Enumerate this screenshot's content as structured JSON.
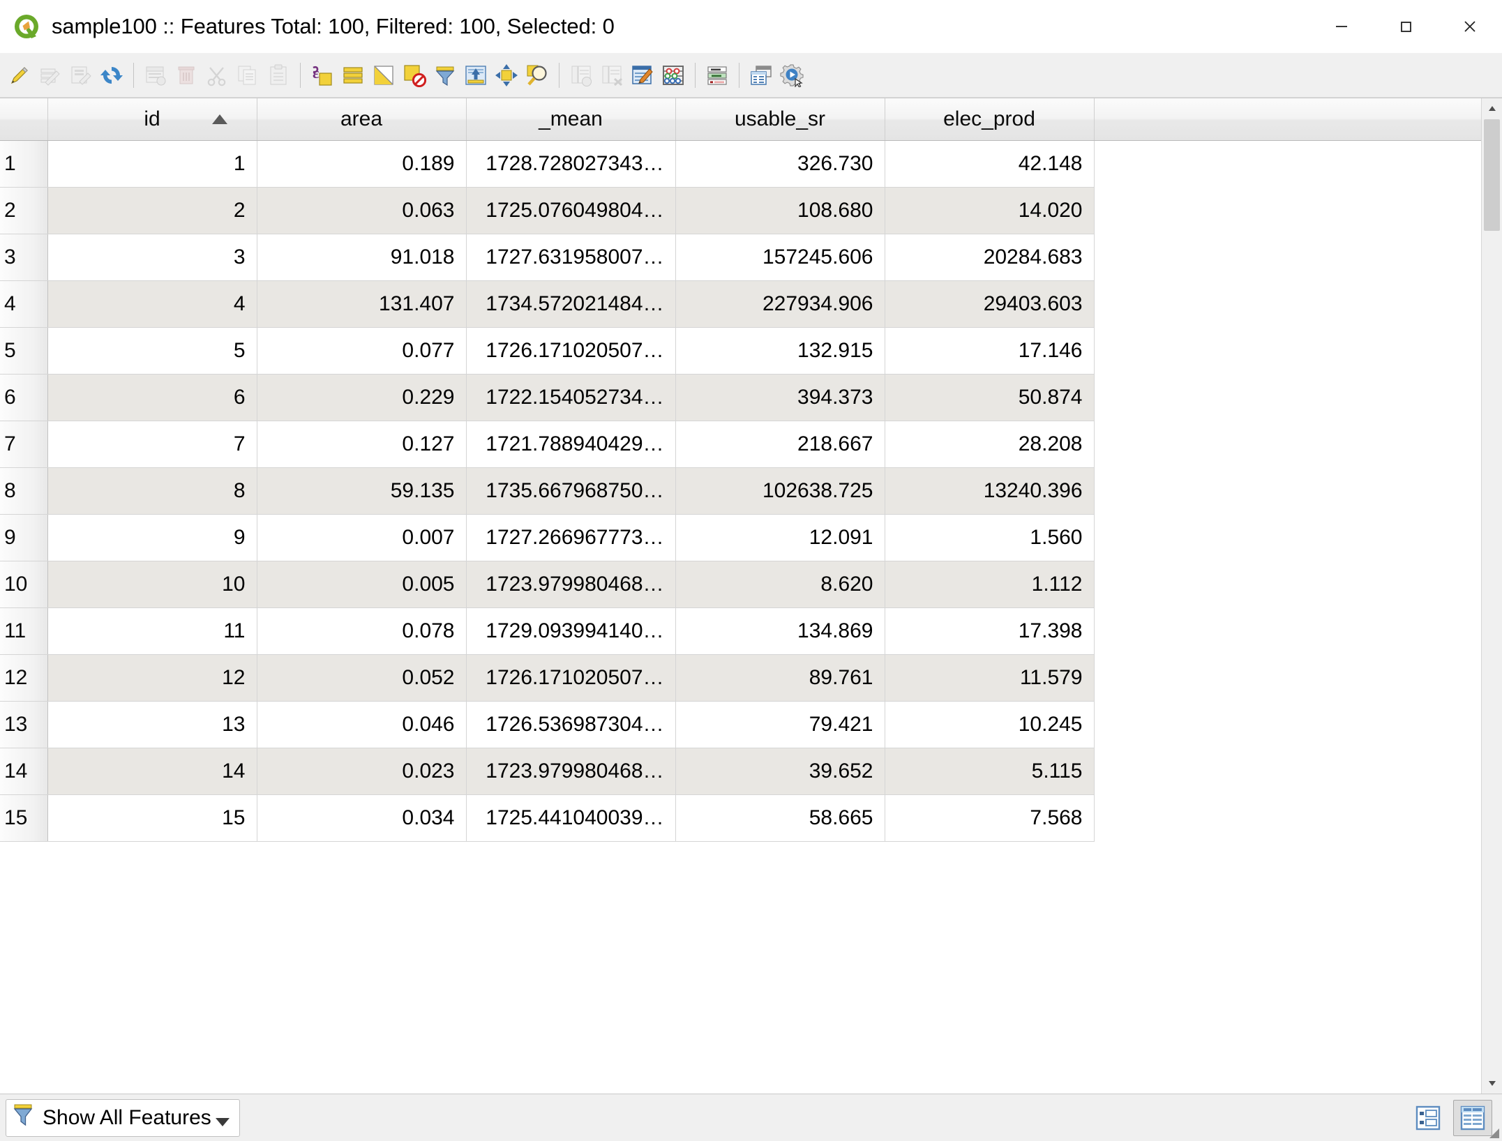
{
  "window": {
    "title": "sample100 :: Features Total: 100, Filtered: 100, Selected: 0",
    "logo_name": "qgis-logo",
    "controls": {
      "minimize": "minimize-button",
      "maximize": "maximize-button",
      "close": "close-button"
    }
  },
  "toolbar": {
    "items": [
      {
        "name": "toggle-editing-icon",
        "tip": "Toggle editing mode",
        "disabled": false
      },
      {
        "name": "multi-edit-icon",
        "tip": "Toggle multi edit mode",
        "disabled": true
      },
      {
        "name": "save-edits-icon",
        "tip": "Save edits",
        "disabled": true
      },
      {
        "name": "reload-table-icon",
        "tip": "Reload the table",
        "disabled": false
      },
      {
        "name": "separator-1",
        "tip": "",
        "disabled": false
      },
      {
        "name": "add-feature-icon",
        "tip": "Add feature",
        "disabled": true
      },
      {
        "name": "delete-selected-icon",
        "tip": "Delete selected features",
        "disabled": true
      },
      {
        "name": "cut-features-icon",
        "tip": "Cut selected features",
        "disabled": true
      },
      {
        "name": "copy-features-icon",
        "tip": "Copy selected features",
        "disabled": true
      },
      {
        "name": "paste-features-icon",
        "tip": "Paste features",
        "disabled": true
      },
      {
        "name": "separator-2",
        "tip": "",
        "disabled": false
      },
      {
        "name": "select-by-expression-icon",
        "tip": "Select features by expression",
        "disabled": false
      },
      {
        "name": "select-all-icon",
        "tip": "Select all features",
        "disabled": false
      },
      {
        "name": "invert-selection-icon",
        "tip": "Invert selection",
        "disabled": false
      },
      {
        "name": "deselect-all-icon",
        "tip": "Deselect all features",
        "disabled": false
      },
      {
        "name": "filter-expression-icon",
        "tip": "Filter features using form",
        "disabled": false
      },
      {
        "name": "move-selection-to-top-icon",
        "tip": "Move selection to top",
        "disabled": false
      },
      {
        "name": "pan-to-selection-icon",
        "tip": "Pan map to selected rows",
        "disabled": false
      },
      {
        "name": "zoom-to-selection-icon",
        "tip": "Zoom map to selected rows",
        "disabled": false
      },
      {
        "name": "separator-3",
        "tip": "",
        "disabled": false
      },
      {
        "name": "new-field-icon",
        "tip": "New field",
        "disabled": true
      },
      {
        "name": "delete-field-icon",
        "tip": "Delete field",
        "disabled": true
      },
      {
        "name": "organize-columns-icon",
        "tip": "Organize columns",
        "disabled": false
      },
      {
        "name": "field-calculator-icon",
        "tip": "Open field calculator",
        "disabled": false
      },
      {
        "name": "separator-4",
        "tip": "",
        "disabled": false
      },
      {
        "name": "conditional-formatting-icon",
        "tip": "Conditional formatting",
        "disabled": false
      },
      {
        "name": "separator-5",
        "tip": "",
        "disabled": false
      },
      {
        "name": "dock-attribute-table-icon",
        "tip": "Dock attribute table",
        "disabled": false
      },
      {
        "name": "run-actions-icon",
        "tip": "Actions",
        "disabled": false
      }
    ]
  },
  "table": {
    "row_header_label": "",
    "sort_column": "id",
    "sort_direction": "ascending",
    "columns": [
      {
        "key": "id",
        "label": "id",
        "sorted": true
      },
      {
        "key": "area",
        "label": "area",
        "sorted": false
      },
      {
        "key": "_mean",
        "label": "_mean",
        "sorted": false
      },
      {
        "key": "usable_sr",
        "label": "usable_sr",
        "sorted": false
      },
      {
        "key": "elec_prod",
        "label": "elec_prod",
        "sorted": false
      }
    ],
    "rows": [
      {
        "n": "1",
        "id": "1",
        "area": "0.189",
        "_mean": "1728.728027343…",
        "usable_sr": "326.730",
        "elec_prod": "42.148"
      },
      {
        "n": "2",
        "id": "2",
        "area": "0.063",
        "_mean": "1725.076049804…",
        "usable_sr": "108.680",
        "elec_prod": "14.020"
      },
      {
        "n": "3",
        "id": "3",
        "area": "91.018",
        "_mean": "1727.631958007…",
        "usable_sr": "157245.606",
        "elec_prod": "20284.683"
      },
      {
        "n": "4",
        "id": "4",
        "area": "131.407",
        "_mean": "1734.572021484…",
        "usable_sr": "227934.906",
        "elec_prod": "29403.603"
      },
      {
        "n": "5",
        "id": "5",
        "area": "0.077",
        "_mean": "1726.171020507…",
        "usable_sr": "132.915",
        "elec_prod": "17.146"
      },
      {
        "n": "6",
        "id": "6",
        "area": "0.229",
        "_mean": "1722.154052734…",
        "usable_sr": "394.373",
        "elec_prod": "50.874"
      },
      {
        "n": "7",
        "id": "7",
        "area": "0.127",
        "_mean": "1721.788940429…",
        "usable_sr": "218.667",
        "elec_prod": "28.208"
      },
      {
        "n": "8",
        "id": "8",
        "area": "59.135",
        "_mean": "1735.667968750…",
        "usable_sr": "102638.725",
        "elec_prod": "13240.396"
      },
      {
        "n": "9",
        "id": "9",
        "area": "0.007",
        "_mean": "1727.266967773…",
        "usable_sr": "12.091",
        "elec_prod": "1.560"
      },
      {
        "n": "10",
        "id": "10",
        "area": "0.005",
        "_mean": "1723.979980468…",
        "usable_sr": "8.620",
        "elec_prod": "1.112"
      },
      {
        "n": "11",
        "id": "11",
        "area": "0.078",
        "_mean": "1729.093994140…",
        "usable_sr": "134.869",
        "elec_prod": "17.398"
      },
      {
        "n": "12",
        "id": "12",
        "area": "0.052",
        "_mean": "1726.171020507…",
        "usable_sr": "89.761",
        "elec_prod": "11.579"
      },
      {
        "n": "13",
        "id": "13",
        "area": "0.046",
        "_mean": "1726.536987304…",
        "usable_sr": "79.421",
        "elec_prod": "10.245"
      },
      {
        "n": "14",
        "id": "14",
        "area": "0.023",
        "_mean": "1723.979980468…",
        "usable_sr": "39.652",
        "elec_prod": "5.115"
      },
      {
        "n": "15",
        "id": "15",
        "area": "0.034",
        "_mean": "1725.441040039…",
        "usable_sr": "58.665",
        "elec_prod": "7.568"
      }
    ]
  },
  "statusbar": {
    "filter_label": "Show All Features",
    "filter_icon": "funnel-icon",
    "views": [
      {
        "name": "form-view-button",
        "active": false
      },
      {
        "name": "table-view-button",
        "active": true
      }
    ]
  },
  "colors": {
    "row_alt": "#e9e7e3",
    "row_base": "#ffffff",
    "header_bg": "#eeeeee",
    "toolbar_bg": "#f0f0f0",
    "accent_yellow": "#f0c419",
    "accent_blue": "#6b95c6",
    "qgis_green": "#589632"
  }
}
